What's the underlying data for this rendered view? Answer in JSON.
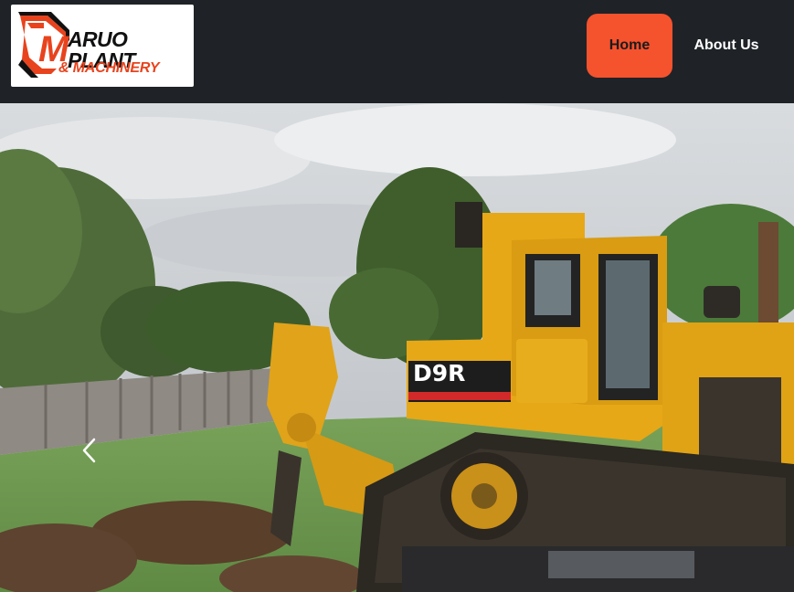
{
  "header": {
    "logo": {
      "line1": "ARUO PLANT",
      "line2": "& MACHINERY",
      "monogram": "M"
    },
    "nav": {
      "home_label": "Home",
      "about_label": "About Us"
    }
  },
  "hero": {
    "machine_plate": "D9R",
    "prev_icon": "chevron-left-icon"
  },
  "colors": {
    "header_bg": "#1f2327",
    "accent": "#f5522e",
    "logo_orange": "#e8431d",
    "machine_yellow": "#e6a817"
  }
}
